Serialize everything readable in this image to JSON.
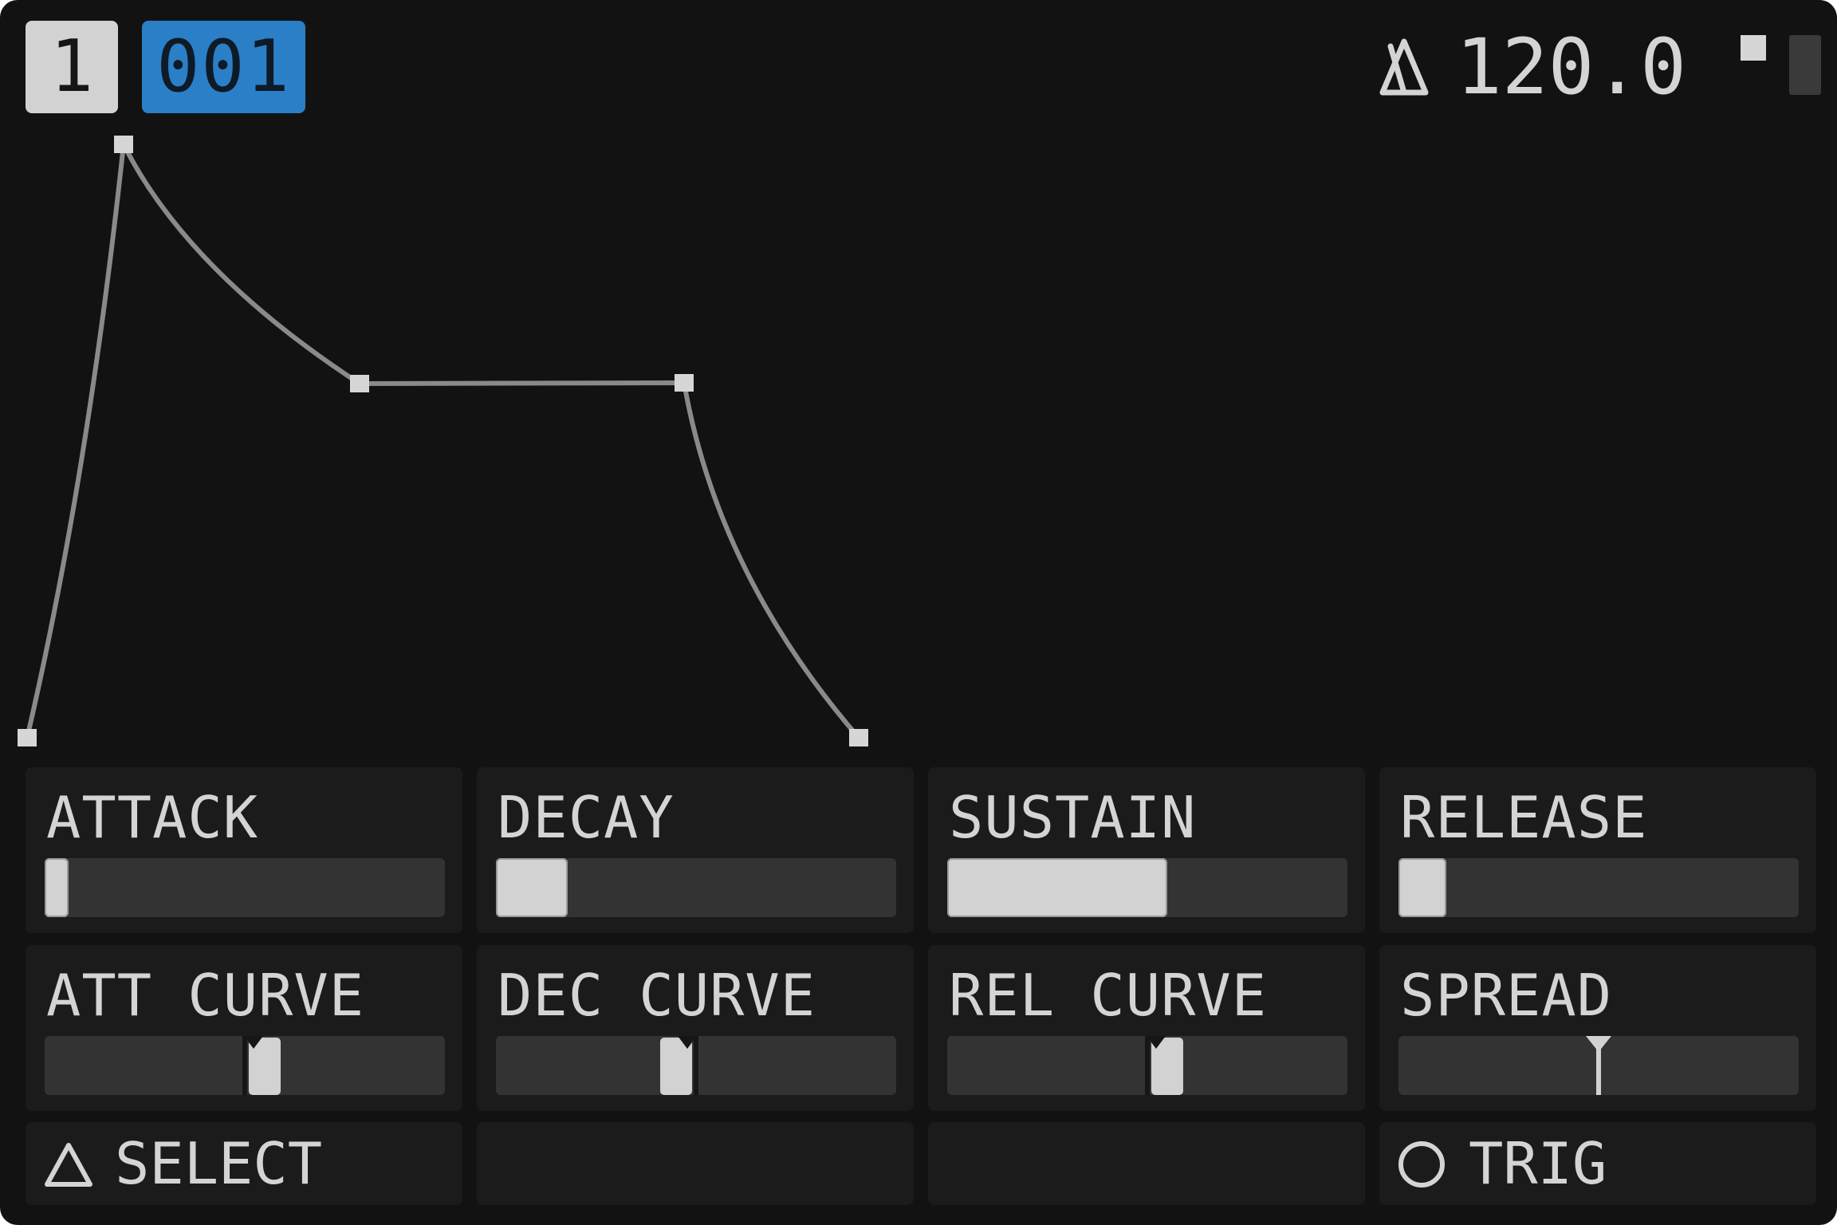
{
  "header": {
    "track": "1",
    "pattern": "001",
    "tempo": "120.0",
    "metronome_icon": "metronome-icon"
  },
  "envelope": {
    "attack": 0.05,
    "decay": 0.18,
    "sustain": 0.55,
    "release": 0.12
  },
  "params": {
    "attack": {
      "label": "ATTACK",
      "value": 0.05
    },
    "decay": {
      "label": "DECAY",
      "value": 0.18
    },
    "sustain": {
      "label": "SUSTAIN",
      "value": 0.55
    },
    "release": {
      "label": "RELEASE",
      "value": 0.12
    },
    "att_curve": {
      "label": "ATT CURVE",
      "value": 0.55
    },
    "dec_curve": {
      "label": "DEC CURVE",
      "value": 0.45
    },
    "rel_curve": {
      "label": "REL CURVE",
      "value": 0.55
    },
    "spread": {
      "label": "SPREAD",
      "value": 0.5
    }
  },
  "actions": {
    "select": {
      "label": "SELECT",
      "icon": "triangle-icon"
    },
    "trig": {
      "label": "TRIG",
      "icon": "circle-icon"
    }
  }
}
